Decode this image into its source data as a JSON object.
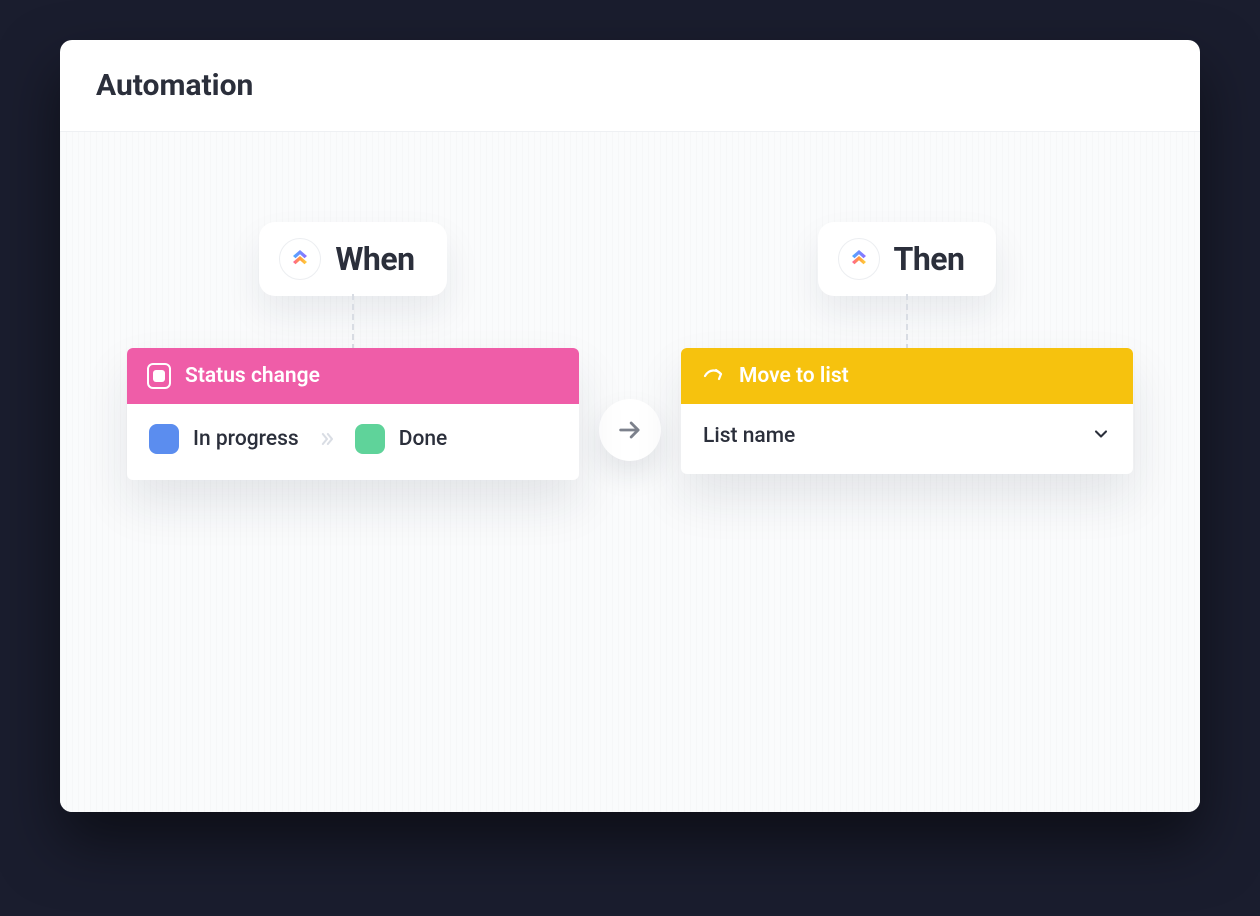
{
  "header": {
    "title": "Automation"
  },
  "trigger": {
    "label": "When",
    "bar_title": "Status change",
    "from_status": "In progress",
    "to_status": "Done",
    "from_color": "#5b8def",
    "to_color": "#5fd39a",
    "bar_color": "#ef5da8"
  },
  "action": {
    "label": "Then",
    "bar_title": "Move to list",
    "select_placeholder": "List name",
    "bar_color": "#f6c20e"
  }
}
